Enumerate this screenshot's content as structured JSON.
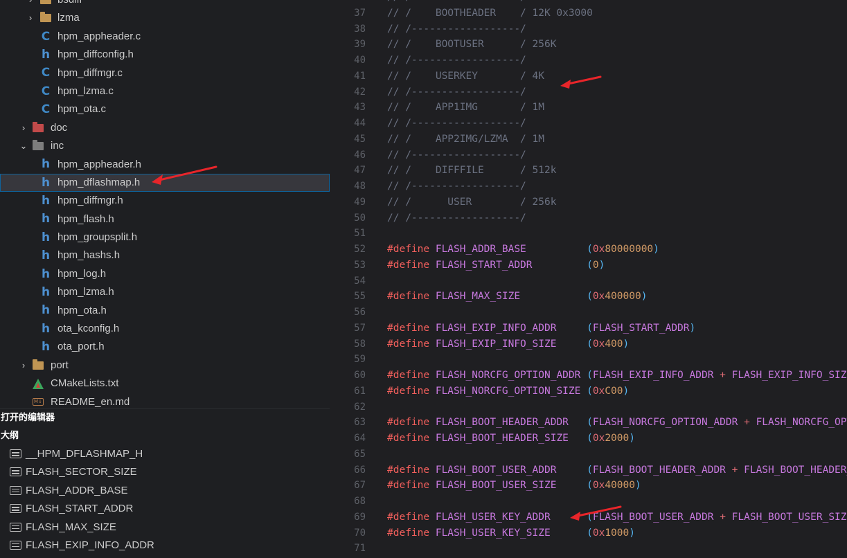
{
  "explorer": {
    "items": [
      {
        "type": "folder",
        "label": "bsdiff",
        "chevron": "›",
        "icon": "folder-icon",
        "depth": 1
      },
      {
        "type": "folder",
        "label": "lzma",
        "chevron": "›",
        "icon": "folder-icon",
        "depth": 1
      },
      {
        "type": "c",
        "label": "hpm_appheader.c",
        "icon": "c-file-icon",
        "depth": 2
      },
      {
        "type": "h",
        "label": "hpm_diffconfig.h",
        "icon": "h-file-icon",
        "depth": 2
      },
      {
        "type": "c",
        "label": "hpm_diffmgr.c",
        "icon": "c-file-icon",
        "depth": 2
      },
      {
        "type": "c",
        "label": "hpm_lzma.c",
        "icon": "c-file-icon",
        "depth": 2
      },
      {
        "type": "c",
        "label": "hpm_ota.c",
        "icon": "c-file-icon",
        "depth": 2
      },
      {
        "type": "folder-doc",
        "label": "doc",
        "chevron": "›",
        "icon": "docs-folder-icon",
        "depth": 0
      },
      {
        "type": "folder-inc",
        "label": "inc",
        "chevron": "⌄",
        "icon": "include-folder-icon",
        "depth": 0
      },
      {
        "type": "h",
        "label": "hpm_appheader.h",
        "icon": "h-file-icon",
        "depth": 2
      },
      {
        "type": "h",
        "label": "hpm_dflashmap.h",
        "icon": "h-file-icon",
        "depth": 2,
        "selected": true
      },
      {
        "type": "h",
        "label": "hpm_diffmgr.h",
        "icon": "h-file-icon",
        "depth": 2
      },
      {
        "type": "h",
        "label": "hpm_flash.h",
        "icon": "h-file-icon",
        "depth": 2
      },
      {
        "type": "h",
        "label": "hpm_groupsplit.h",
        "icon": "h-file-icon",
        "depth": 2
      },
      {
        "type": "h",
        "label": "hpm_hashs.h",
        "icon": "h-file-icon",
        "depth": 2
      },
      {
        "type": "h",
        "label": "hpm_log.h",
        "icon": "h-file-icon",
        "depth": 2
      },
      {
        "type": "h",
        "label": "hpm_lzma.h",
        "icon": "h-file-icon",
        "depth": 2
      },
      {
        "type": "h",
        "label": "hpm_ota.h",
        "icon": "h-file-icon",
        "depth": 2
      },
      {
        "type": "h",
        "label": "ota_kconfig.h",
        "icon": "h-file-icon",
        "depth": 2
      },
      {
        "type": "h",
        "label": "ota_port.h",
        "icon": "h-file-icon",
        "depth": 2
      },
      {
        "type": "folder",
        "label": "port",
        "chevron": "›",
        "icon": "folder-icon",
        "depth": 0
      },
      {
        "type": "cmake",
        "label": "CMakeLists.txt",
        "icon": "cmake-icon",
        "depth": 1
      },
      {
        "type": "md",
        "label": "README_en.md",
        "icon": "markdown-icon",
        "depth": 1
      }
    ]
  },
  "open_editors_header": "打开的编辑器",
  "outline_header": "大纲",
  "outline": {
    "items": [
      "__HPM_DFLASHMAP_H",
      "FLASH_SECTOR_SIZE",
      "FLASH_ADDR_BASE",
      "FLASH_START_ADDR",
      "FLASH_MAX_SIZE",
      "FLASH_EXIP_INFO_ADDR"
    ]
  },
  "editor": {
    "lines": [
      {
        "n": "36",
        "tokens": [
          [
            "com",
            "// / ---------------- /"
          ]
        ]
      },
      {
        "n": "37",
        "tokens": [
          [
            "com",
            "// /    BOOTHEADER    / 12K 0x3000"
          ]
        ]
      },
      {
        "n": "38",
        "tokens": [
          [
            "com",
            "// /------------------/"
          ]
        ]
      },
      {
        "n": "39",
        "tokens": [
          [
            "com",
            "// /    BOOTUSER      / 256K"
          ]
        ]
      },
      {
        "n": "40",
        "tokens": [
          [
            "com",
            "// /------------------/"
          ]
        ]
      },
      {
        "n": "41",
        "tokens": [
          [
            "com",
            "// /    USERKEY       / 4K"
          ]
        ]
      },
      {
        "n": "42",
        "tokens": [
          [
            "com",
            "// /------------------/"
          ]
        ]
      },
      {
        "n": "43",
        "tokens": [
          [
            "com",
            "// /    APP1IMG       / 1M"
          ]
        ]
      },
      {
        "n": "44",
        "tokens": [
          [
            "com",
            "// /------------------/"
          ]
        ]
      },
      {
        "n": "45",
        "tokens": [
          [
            "com",
            "// /    APP2IMG/LZMA  / 1M"
          ]
        ]
      },
      {
        "n": "46",
        "tokens": [
          [
            "com",
            "// /------------------/"
          ]
        ]
      },
      {
        "n": "47",
        "tokens": [
          [
            "com",
            "// /    DIFFFILE      / 512k"
          ]
        ]
      },
      {
        "n": "48",
        "tokens": [
          [
            "com",
            "// /------------------/"
          ]
        ]
      },
      {
        "n": "49",
        "tokens": [
          [
            "com",
            "// /      USER        / 256k"
          ]
        ]
      },
      {
        "n": "50",
        "tokens": [
          [
            "com",
            "// /------------------/"
          ]
        ]
      },
      {
        "n": "51",
        "tokens": []
      },
      {
        "n": "52",
        "tokens": [
          [
            "def",
            "#define"
          ],
          [
            "plain",
            " "
          ],
          [
            "mac",
            "FLASH_ADDR_BASE"
          ],
          [
            "plain",
            "          "
          ],
          [
            "paren",
            "("
          ],
          [
            "hex",
            "0x"
          ],
          [
            "num",
            "80000000"
          ],
          [
            "paren",
            ")"
          ]
        ]
      },
      {
        "n": "53",
        "tokens": [
          [
            "def",
            "#define"
          ],
          [
            "plain",
            " "
          ],
          [
            "mac",
            "FLASH_START_ADDR"
          ],
          [
            "plain",
            "         "
          ],
          [
            "paren",
            "("
          ],
          [
            "num",
            "0"
          ],
          [
            "paren",
            ")"
          ]
        ]
      },
      {
        "n": "54",
        "tokens": []
      },
      {
        "n": "55",
        "tokens": [
          [
            "def",
            "#define"
          ],
          [
            "plain",
            " "
          ],
          [
            "mac",
            "FLASH_MAX_SIZE"
          ],
          [
            "plain",
            "           "
          ],
          [
            "paren",
            "("
          ],
          [
            "hex",
            "0x"
          ],
          [
            "num",
            "400000"
          ],
          [
            "paren",
            ")"
          ]
        ]
      },
      {
        "n": "56",
        "tokens": []
      },
      {
        "n": "57",
        "tokens": [
          [
            "def",
            "#define"
          ],
          [
            "plain",
            " "
          ],
          [
            "mac",
            "FLASH_EXIP_INFO_ADDR"
          ],
          [
            "plain",
            "     "
          ],
          [
            "paren",
            "("
          ],
          [
            "mac",
            "FLASH_START_ADDR"
          ],
          [
            "paren",
            ")"
          ]
        ]
      },
      {
        "n": "58",
        "tokens": [
          [
            "def",
            "#define"
          ],
          [
            "plain",
            " "
          ],
          [
            "mac",
            "FLASH_EXIP_INFO_SIZE"
          ],
          [
            "plain",
            "     "
          ],
          [
            "paren",
            "("
          ],
          [
            "hex",
            "0x"
          ],
          [
            "num",
            "400"
          ],
          [
            "paren",
            ")"
          ]
        ]
      },
      {
        "n": "59",
        "tokens": []
      },
      {
        "n": "60",
        "tokens": [
          [
            "def",
            "#define"
          ],
          [
            "plain",
            " "
          ],
          [
            "mac",
            "FLASH_NORCFG_OPTION_ADDR"
          ],
          [
            "plain",
            " "
          ],
          [
            "paren",
            "("
          ],
          [
            "mac",
            "FLASH_EXIP_INFO_ADDR"
          ],
          [
            "plain",
            " "
          ],
          [
            "op",
            "+"
          ],
          [
            "plain",
            " "
          ],
          [
            "mac",
            "FLASH_EXIP_INFO_SIZE"
          ],
          [
            "paren",
            ")"
          ]
        ]
      },
      {
        "n": "61",
        "tokens": [
          [
            "def",
            "#define"
          ],
          [
            "plain",
            " "
          ],
          [
            "mac",
            "FLASH_NORCFG_OPTION_SIZE"
          ],
          [
            "plain",
            " "
          ],
          [
            "paren",
            "("
          ],
          [
            "hex",
            "0x"
          ],
          [
            "num",
            "C00"
          ],
          [
            "paren",
            ")"
          ]
        ]
      },
      {
        "n": "62",
        "tokens": []
      },
      {
        "n": "63",
        "tokens": [
          [
            "def",
            "#define"
          ],
          [
            "plain",
            " "
          ],
          [
            "mac",
            "FLASH_BOOT_HEADER_ADDR"
          ],
          [
            "plain",
            "   "
          ],
          [
            "paren",
            "("
          ],
          [
            "mac",
            "FLASH_NORCFG_OPTION_ADDR"
          ],
          [
            "plain",
            " "
          ],
          [
            "op",
            "+"
          ],
          [
            "plain",
            " "
          ],
          [
            "mac",
            "FLASH_NORCFG_OPTION_SIZE"
          ],
          [
            "paren",
            ")"
          ]
        ]
      },
      {
        "n": "64",
        "tokens": [
          [
            "def",
            "#define"
          ],
          [
            "plain",
            " "
          ],
          [
            "mac",
            "FLASH_BOOT_HEADER_SIZE"
          ],
          [
            "plain",
            "   "
          ],
          [
            "paren",
            "("
          ],
          [
            "hex",
            "0x"
          ],
          [
            "num",
            "2000"
          ],
          [
            "paren",
            ")"
          ]
        ]
      },
      {
        "n": "65",
        "tokens": []
      },
      {
        "n": "66",
        "tokens": [
          [
            "def",
            "#define"
          ],
          [
            "plain",
            " "
          ],
          [
            "mac",
            "FLASH_BOOT_USER_ADDR"
          ],
          [
            "plain",
            "     "
          ],
          [
            "paren",
            "("
          ],
          [
            "mac",
            "FLASH_BOOT_HEADER_ADDR"
          ],
          [
            "plain",
            " "
          ],
          [
            "op",
            "+"
          ],
          [
            "plain",
            " "
          ],
          [
            "mac",
            "FLASH_BOOT_HEADER_SIZE"
          ],
          [
            "paren",
            ")"
          ]
        ]
      },
      {
        "n": "67",
        "tokens": [
          [
            "def",
            "#define"
          ],
          [
            "plain",
            " "
          ],
          [
            "mac",
            "FLASH_BOOT_USER_SIZE"
          ],
          [
            "plain",
            "     "
          ],
          [
            "paren",
            "("
          ],
          [
            "hex",
            "0x"
          ],
          [
            "num",
            "40000"
          ],
          [
            "paren",
            ")"
          ]
        ]
      },
      {
        "n": "68",
        "tokens": []
      },
      {
        "n": "69",
        "tokens": [
          [
            "def",
            "#define"
          ],
          [
            "plain",
            " "
          ],
          [
            "mac",
            "FLASH_USER_KEY_ADDR"
          ],
          [
            "plain",
            "      "
          ],
          [
            "paren",
            "("
          ],
          [
            "mac",
            "FLASH_BOOT_USER_ADDR"
          ],
          [
            "plain",
            " "
          ],
          [
            "op",
            "+"
          ],
          [
            "plain",
            " "
          ],
          [
            "mac",
            "FLASH_BOOT_USER_SIZE"
          ],
          [
            "paren",
            ")"
          ]
        ]
      },
      {
        "n": "70",
        "tokens": [
          [
            "def",
            "#define"
          ],
          [
            "plain",
            " "
          ],
          [
            "mac",
            "FLASH_USER_KEY_SIZE"
          ],
          [
            "plain",
            "      "
          ],
          [
            "paren",
            "("
          ],
          [
            "hex",
            "0x"
          ],
          [
            "num",
            "1000"
          ],
          [
            "paren",
            ")"
          ]
        ]
      },
      {
        "n": "71",
        "tokens": []
      }
    ]
  },
  "annotation_color": "#e8252a",
  "colors": {
    "sidebar_bg": "#1e1f22",
    "editor_bg": "#1f1f22",
    "selection_border": "#0e639c",
    "define_keyword": "#f25f5c",
    "macro": "#c678dd",
    "paren": "#56b6f2",
    "comment": "#6a7080"
  }
}
